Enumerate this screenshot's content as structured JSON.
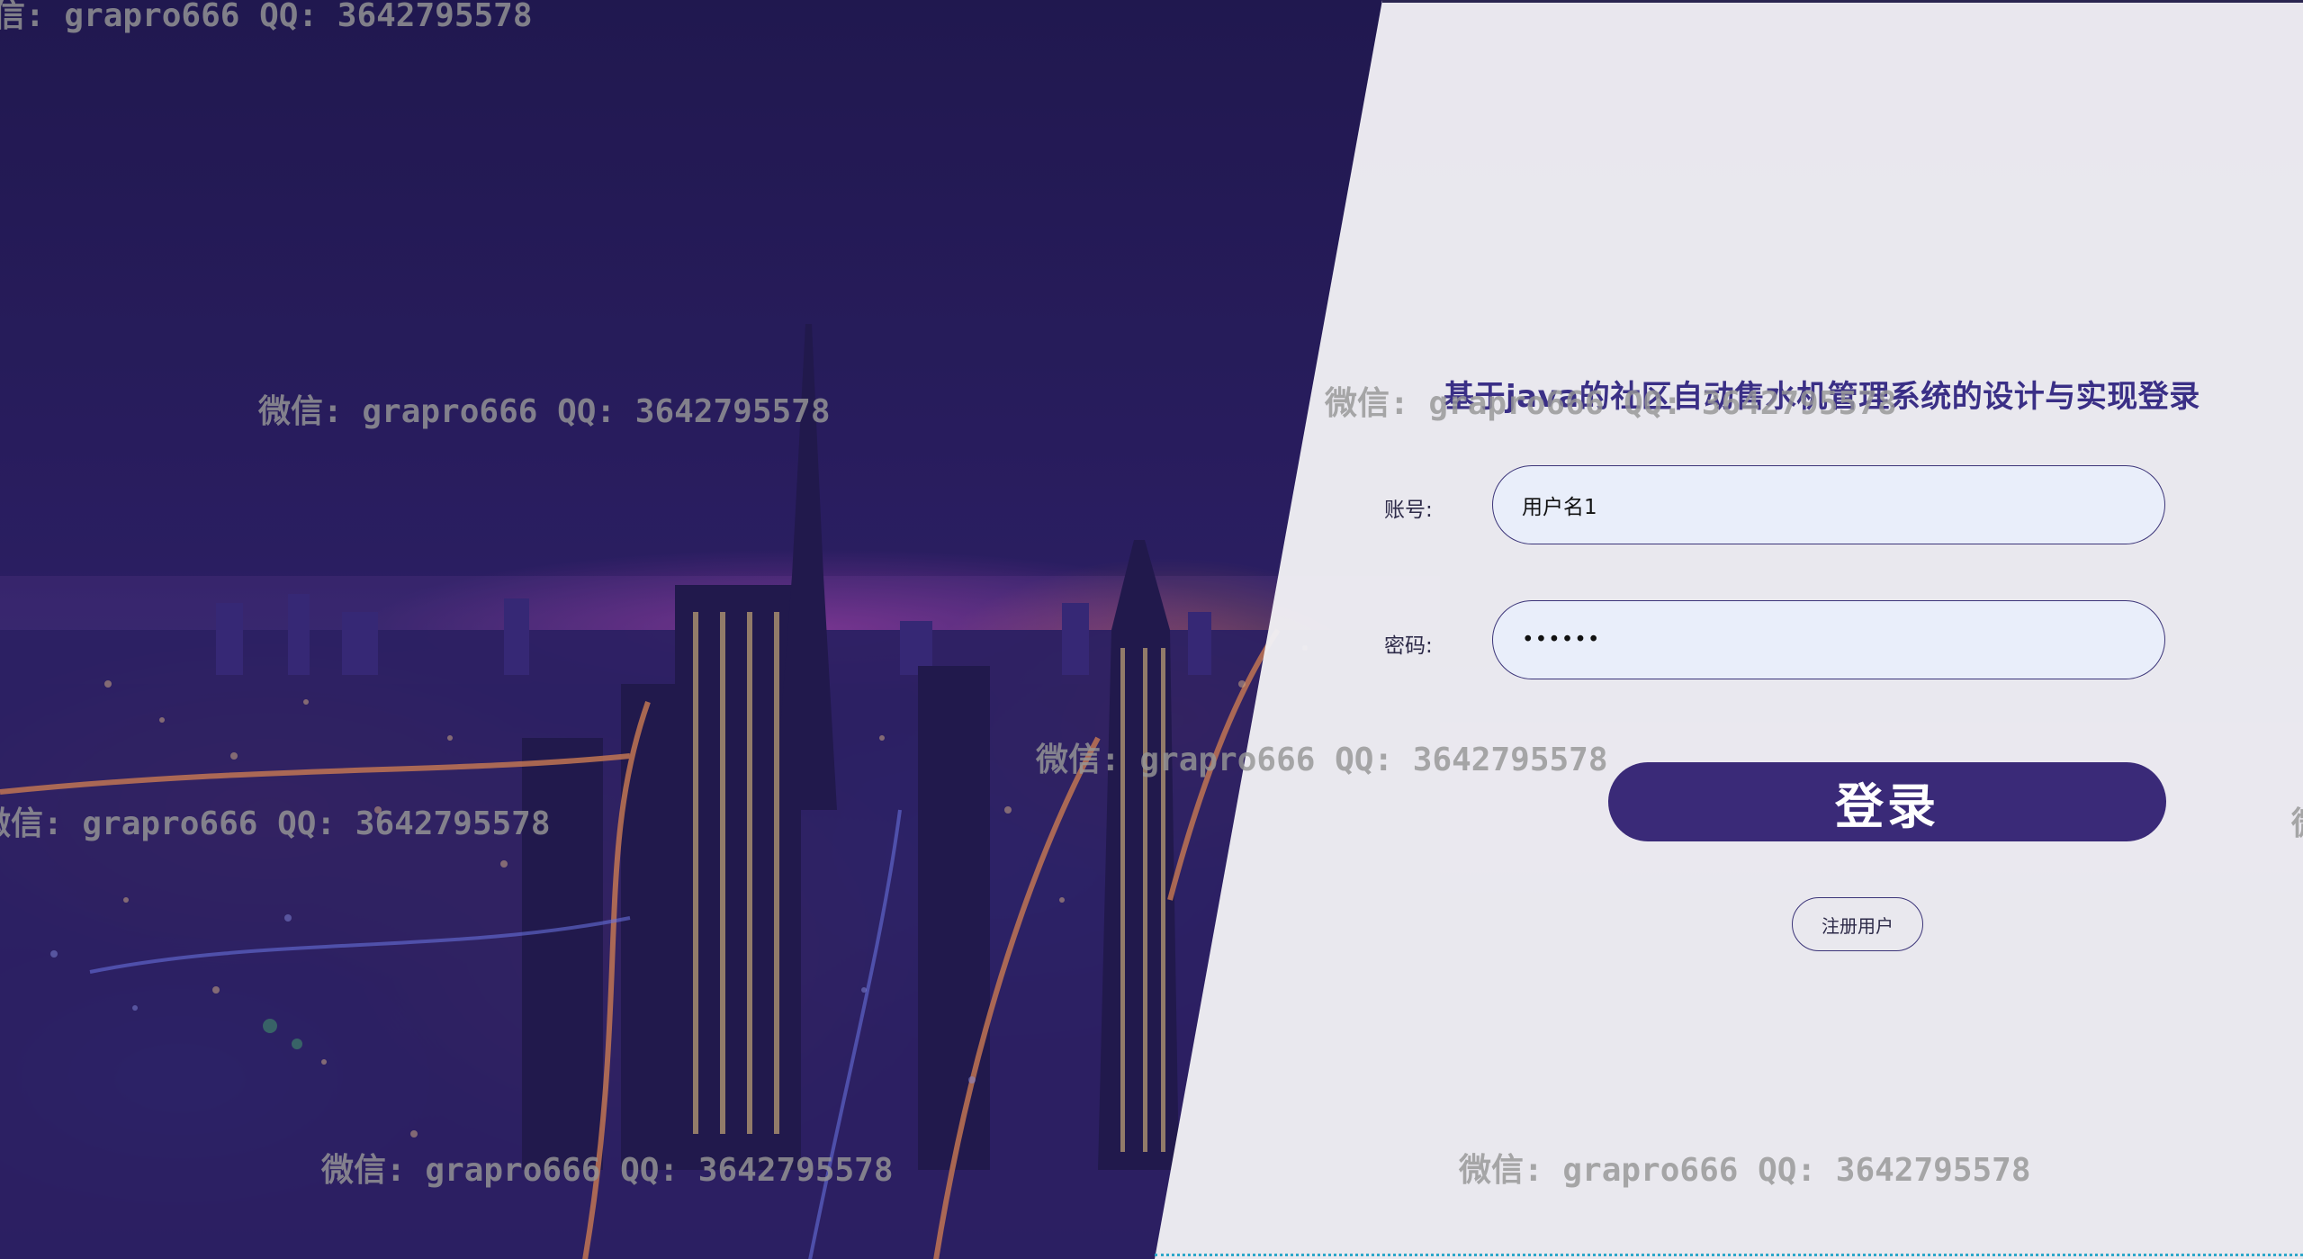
{
  "login": {
    "title": "基于java的社区自动售水机管理系统的设计与实现登录",
    "username_label": "账号:",
    "username_value": "用户名1",
    "password_label": "密码:",
    "password_value": "••••••",
    "login_button": "登录",
    "register_button": "注册用户"
  },
  "watermark": {
    "text": "微信: grapro666 QQ: 3642795578",
    "partial_top": "信: grapro666 QQ: 3642795578",
    "partial_left": "微信: grapro666 QQ: 3642795578",
    "partial_right": "微"
  },
  "colors": {
    "primary": "#3a2a78",
    "title": "#3a2f86",
    "input_bg": "#e9eefa",
    "panel_bg": "#f0eff4",
    "night_sky": "#1b1640"
  },
  "icons": {
    "background": "city-night-skyline-image"
  }
}
